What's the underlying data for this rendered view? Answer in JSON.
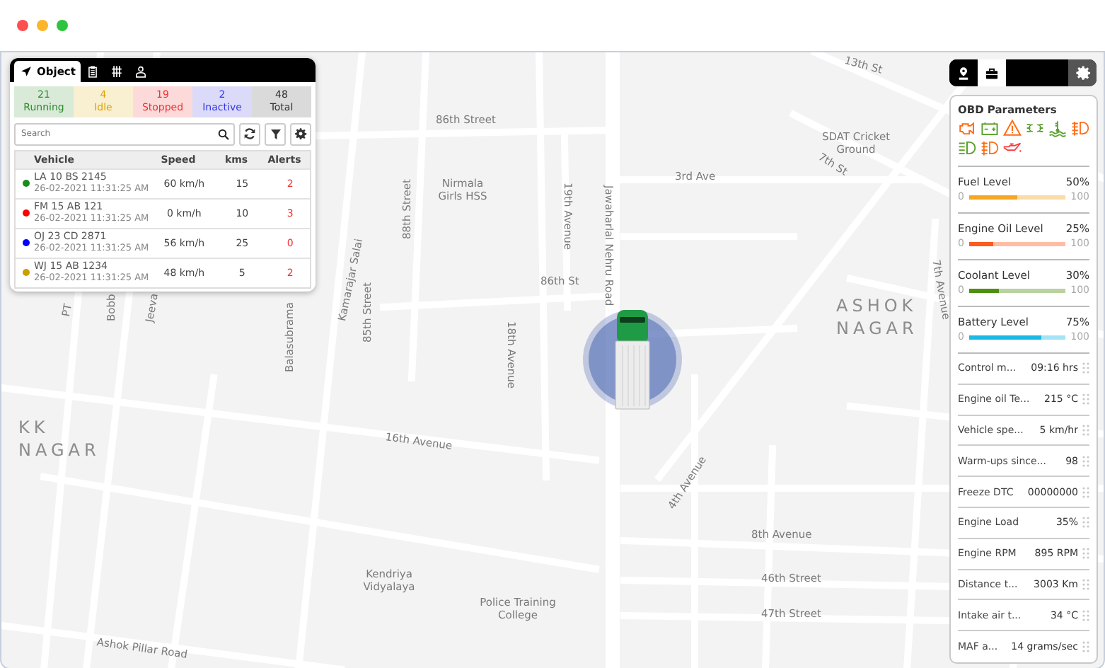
{
  "map": {
    "labels": [
      {
        "text": "13th St",
        "kind": "street"
      },
      {
        "text": "86th Street",
        "kind": "street"
      },
      {
        "text": "Nirmala Girls HSS",
        "kind": "place"
      },
      {
        "text": "SDAT Cricket Ground",
        "kind": "place"
      },
      {
        "text": "3rd Ave",
        "kind": "street"
      },
      {
        "text": "7th St",
        "kind": "street"
      },
      {
        "text": "19th Avenue",
        "kind": "street"
      },
      {
        "text": "Jawaharlal Nehru Road",
        "kind": "street"
      },
      {
        "text": "88th Street",
        "kind": "street"
      },
      {
        "text": "Kamarajar Salai",
        "kind": "street"
      },
      {
        "text": "85th Street",
        "kind": "street"
      },
      {
        "text": "86th St",
        "kind": "street"
      },
      {
        "text": "18th Avenue",
        "kind": "street"
      },
      {
        "text": "ASHOK NAGAR",
        "kind": "area"
      },
      {
        "text": "7th Avenue",
        "kind": "street"
      },
      {
        "text": "Balasubrama",
        "kind": "street"
      },
      {
        "text": "Bobb",
        "kind": "street"
      },
      {
        "text": "Jeeva",
        "kind": "street"
      },
      {
        "text": "PT",
        "kind": "street"
      },
      {
        "text": "KK NAGAR",
        "kind": "area"
      },
      {
        "text": "16th Avenue",
        "kind": "street"
      },
      {
        "text": "4th Avenue",
        "kind": "street"
      },
      {
        "text": "8th Avenue",
        "kind": "street"
      },
      {
        "text": "Kendriya Vidyalaya",
        "kind": "place"
      },
      {
        "text": "Police Training College",
        "kind": "place"
      },
      {
        "text": "46th Street",
        "kind": "street"
      },
      {
        "text": "47th Street",
        "kind": "street"
      },
      {
        "text": "Ashok Pillar Road",
        "kind": "street"
      }
    ]
  },
  "object_panel": {
    "tabs": [
      {
        "label": "Object",
        "kind": "navigation",
        "selected": true
      },
      {
        "kind": "clipboard",
        "selected": false
      },
      {
        "kind": "grid",
        "selected": false
      },
      {
        "kind": "person",
        "selected": false
      }
    ],
    "summary": [
      {
        "count": "21",
        "label": "Running",
        "color": "#2e8b2e"
      },
      {
        "count": "4",
        "label": "Idle",
        "color": "#e0a400"
      },
      {
        "count": "19",
        "label": "Stopped",
        "color": "#f03030"
      },
      {
        "count": "2",
        "label": "Inactive",
        "color": "#3535e0"
      },
      {
        "count": "48",
        "label": "Total",
        "color": "#333333"
      }
    ],
    "search": {
      "placeholder": "Search"
    },
    "table": {
      "columns": [
        "Vehicle",
        "Speed",
        "kms",
        "Alerts"
      ],
      "rows": [
        {
          "vehicle": "LA 10 BS 2145",
          "time": "26-02-2021 11:31:25 AM",
          "speed": "60 km/h",
          "kms": "15",
          "alerts": "2",
          "color": "#1a8c1a"
        },
        {
          "vehicle": "FM 15 AB 121",
          "time": "26-02-2021 11:31:25 AM",
          "speed": "0 km/h",
          "kms": "10",
          "alerts": "3",
          "color": "#ff0000"
        },
        {
          "vehicle": "OJ 23 CD 2871",
          "time": "26-02-2021 11:31:25 AM",
          "speed": "56 km/h",
          "kms": "25",
          "alerts": "0",
          "color": "#0000ff"
        },
        {
          "vehicle": "WJ 15 AB 1234",
          "time": "26-02-2021 11:31:25 AM",
          "speed": "48 km/h",
          "kms": "5",
          "alerts": "2",
          "color": "#c9a000"
        }
      ]
    }
  },
  "obd_panel": {
    "tabs": [
      {
        "kind": "pin",
        "selected": false
      },
      {
        "kind": "briefcase",
        "selected": true
      }
    ],
    "title": "OBD Parameters",
    "indicators": [
      {
        "kind": "engine",
        "color": "#ff6a13"
      },
      {
        "kind": "battery",
        "color": "#5aa02c"
      },
      {
        "kind": "warning",
        "color": "#ff6a13"
      },
      {
        "kind": "lights",
        "color": "#5aa02c"
      },
      {
        "kind": "coolant",
        "color": "#5aa02c"
      },
      {
        "kind": "fog",
        "color": "#ff6a13"
      },
      {
        "kind": "beam",
        "color": "#5aa02c"
      },
      {
        "kind": "fog",
        "color": "#ff6a13"
      },
      {
        "kind": "oil",
        "color": "#ff3b3b"
      }
    ],
    "levels": [
      {
        "label": "Fuel Level",
        "reading": "50%",
        "min": "0",
        "max": "100",
        "level": 0.5,
        "color": "#f5a623"
      },
      {
        "label": "Engine Oil Level",
        "reading": "25%",
        "min": "0",
        "max": "100",
        "level": 0.25,
        "color": "#ff5a1f"
      },
      {
        "label": "Coolant Level",
        "reading": "30%",
        "min": "0",
        "max": "100",
        "level": 0.3,
        "color": "#4f8f0f"
      },
      {
        "label": "Battery Level",
        "reading": "75%",
        "min": "0",
        "max": "100",
        "level": 0.75,
        "color": "#1ab9e6"
      }
    ],
    "params": [
      {
        "label": "Control m...",
        "value": "09:16 hrs"
      },
      {
        "label": "Engine oil Te...",
        "value": "215 °C"
      },
      {
        "label": "Vehicle spe...",
        "value": "5 km/hr"
      },
      {
        "label": "Warm-ups since...",
        "value": "98"
      },
      {
        "label": "Freeze DTC",
        "value": "00000000"
      },
      {
        "label": "Engine Load",
        "value": "35%"
      },
      {
        "label": "Engine RPM",
        "value": "895 RPM"
      },
      {
        "label": "Distance t...",
        "value": "3003 Km"
      },
      {
        "label": "Intake air t...",
        "value": "34 °C"
      },
      {
        "label": "MAF a...",
        "value": "14 grams/sec"
      }
    ]
  }
}
